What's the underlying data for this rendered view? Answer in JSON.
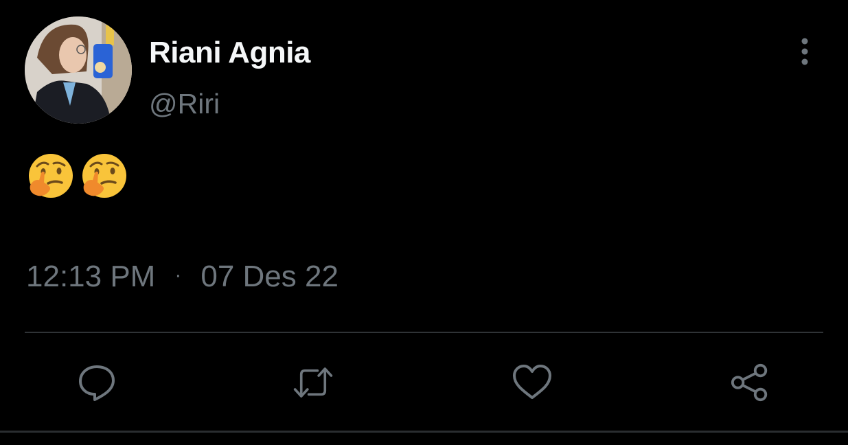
{
  "author": {
    "display_name": "Riani Agnia",
    "handle": "@Riri"
  },
  "tweet": {
    "content_emojis": [
      "thinking-face-emoji",
      "thinking-face-emoji"
    ],
    "time": "12:13 PM",
    "separator": "·",
    "date": "07 Des 22"
  },
  "actions": {
    "icons": [
      "reply-icon",
      "retweet-icon",
      "like-icon",
      "share-icon"
    ]
  },
  "colors": {
    "background": "#000000",
    "name_text": "#f5f7f8",
    "secondary_text": "#6e767d",
    "icon": "#6e767d",
    "divider": "#2f3336",
    "emoji_yellow": "#f9c43a",
    "emoji_hand": "#f08a2c"
  }
}
